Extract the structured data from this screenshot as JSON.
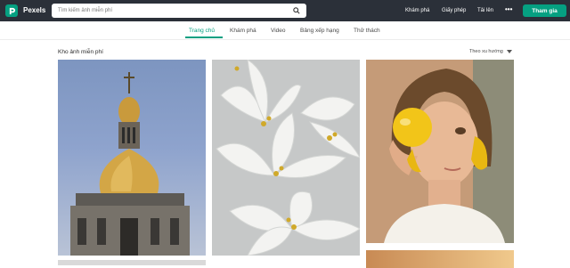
{
  "header": {
    "brand": "Pexels",
    "search_placeholder": "Tìm kiếm ảnh miễn phí",
    "nav": [
      "Khám phá",
      "Giấy phép",
      "Tải lên"
    ],
    "more": "•••",
    "join_label": "Tham gia"
  },
  "tabs": [
    {
      "label": "Trang chủ",
      "active": true
    },
    {
      "label": "Khám phá",
      "active": false
    },
    {
      "label": "Video",
      "active": false
    },
    {
      "label": "Bảng xếp hạng",
      "active": false
    },
    {
      "label": "Thử thách",
      "active": false
    }
  ],
  "section": {
    "title": "Kho ảnh miễn phí",
    "sort_label": "Theo xu hướng"
  },
  "colors": {
    "topbar": "#2b3039",
    "accent": "#05a081"
  }
}
